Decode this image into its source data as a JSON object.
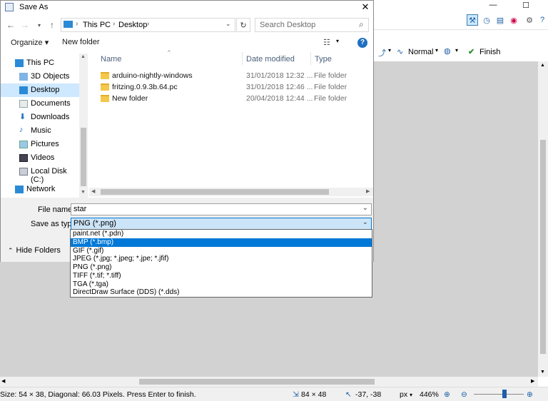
{
  "dialog": {
    "title": "Save As",
    "close_glyph": "✕",
    "address": [
      "This PC",
      "Desktop"
    ],
    "search_placeholder": "Search Desktop",
    "organize_label": "Organize ▾",
    "new_folder_label": "New folder",
    "help_glyph": "?"
  },
  "nav_pane": {
    "items": [
      {
        "label": "This PC",
        "icon": "pc-icon"
      },
      {
        "label": "3D Objects",
        "icon": "cube-icon"
      },
      {
        "label": "Desktop",
        "icon": "desktop-icon",
        "selected": true
      },
      {
        "label": "Documents",
        "icon": "documents-icon"
      },
      {
        "label": "Downloads",
        "icon": "download-icon"
      },
      {
        "label": "Music",
        "icon": "music-icon"
      },
      {
        "label": "Pictures",
        "icon": "pictures-icon"
      },
      {
        "label": "Videos",
        "icon": "videos-icon"
      },
      {
        "label": "Local Disk (C:)",
        "icon": "disk-icon"
      },
      {
        "label": "Network",
        "icon": "network-icon"
      }
    ]
  },
  "file_list": {
    "columns": {
      "name": "Name",
      "date": "Date modified",
      "type": "Type"
    },
    "rows": [
      {
        "name": "arduino-nightly-windows",
        "date": "31/01/2018 12:32 ...",
        "type": "File folder"
      },
      {
        "name": "fritzing.0.9.3b.64.pc",
        "date": "31/01/2018 12:46 ...",
        "type": "File folder"
      },
      {
        "name": "New folder",
        "date": "20/04/2018 12:44 ...",
        "type": "File folder"
      }
    ]
  },
  "form": {
    "file_name_label": "File name:",
    "file_name_value": "star",
    "save_type_label": "Save as type:",
    "save_type_value": "PNG (*.png)",
    "hide_folders_label": "Hide Folders",
    "type_options": [
      {
        "label": "paint.net (*.pdn)"
      },
      {
        "label": "BMP (*.bmp)",
        "selected": true
      },
      {
        "label": "GIF (*.gif)"
      },
      {
        "label": "JPEG (*.jpg; *.jpeg; *.jpe; *.jfif)"
      },
      {
        "label": "PNG (*.png)"
      },
      {
        "label": "TIFF (*.tif; *.tiff)"
      },
      {
        "label": "TGA (*.tga)"
      },
      {
        "label": "DirectDraw Surface (DDS) (*.dds)"
      }
    ]
  },
  "app": {
    "toolbar2": {
      "blend_mode": "Normal",
      "finish_label": "Finish"
    },
    "status": {
      "message": "Size: 54 × 38, Diagonal: 66.03 Pixels. Press Enter to finish.",
      "image_size": "84 × 48",
      "cursor": "-37, -38",
      "units": "px",
      "zoom": "446%"
    }
  },
  "colors": {
    "accent": "#0078d7",
    "selection": "#cde8ff",
    "canvas_bg": "#d2d2d2",
    "folder": "#f4c84a"
  }
}
